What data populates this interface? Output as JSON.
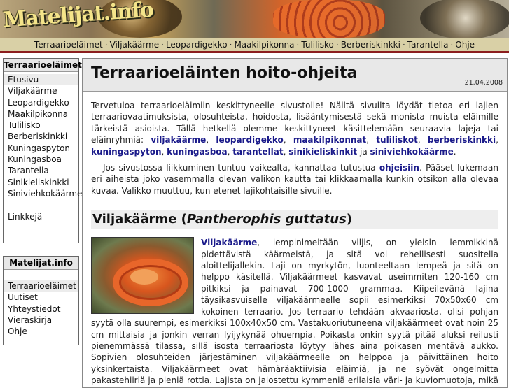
{
  "header": {
    "logo_text": "Matelijat.info"
  },
  "topnav": [
    "Terraarioeläimet",
    "Viljakäärme",
    "Leopardigekko",
    "Maakilpikonna",
    "Tulilisko",
    "Berberiskinkki",
    "Tarantella",
    "Ohje"
  ],
  "sidebar_animals": {
    "title": "Terraarioeläimet",
    "items": [
      "Etusivu",
      "Viljakäärme",
      "Leopardigekko",
      "Maakilpikonna",
      "Tulilisko",
      "Berberiskinkki",
      "Kuningaspyton",
      "Kuningasboa",
      "Tarantella",
      "Sinikieliskinkki",
      "Siniviehkokäärme"
    ],
    "extra": "Linkkejä"
  },
  "sidebar_site": {
    "title": "Matelijat.info",
    "items": [
      "Terraarioeläimet",
      "Uutiset",
      "Yhteystiedot",
      "Vieraskirja",
      "Ohje"
    ]
  },
  "main": {
    "title": "Terraarioeläinten hoito-ohjeita",
    "date": "21.04.2008",
    "intro": {
      "text1": "Tervetuloa terraarioeläimiin keskittyneelle sivustolle! Näiltä sivuilta löydät tietoa eri lajien terraariovaatimuksista, olosuhteista, hoidosta, lisääntymisestä sekä monista muista eläimille tärkeistä asioista. Tällä hetkellä olemme keskittyneet käsittelemään seuraavia lajeja tai eläinryhmiä: ",
      "links": [
        "viljakäärme",
        "leopardigekko",
        "maakilpikonnat",
        "tuliliskot",
        "berberiskinkki",
        "kuningaspyton",
        "kuningasboa",
        "tarantellat",
        "sinikieliskinkit",
        "siniviehkokäärme"
      ],
      "text_and": " ja ",
      "end": "."
    },
    "help": {
      "before": "Jos sivustossa liikkuminen tuntuu vaikealta, kannattaa tutustua ",
      "link": "ohjeisiin",
      "after": ". Pääset lukemaan eri aiheista joko vasemmalla olevan valikon kautta tai klikkaamalla kunkin otsikon alla olevaa kuvaa. Valikko muuttuu, kun etenet lajikohtaisille sivuille."
    },
    "section": {
      "heading_plain": "Viljakäärme (",
      "heading_italic": "Pantherophis guttatus",
      "heading_close": ")",
      "link": "Viljakäärme",
      "text": ", lempinimeltään viljis, on yleisin lemmikkinä pidettävistä käärmeistä, ja sitä voi rehellisesti suositella aloittelijallekin. Laji on myrkytön, luonteeltaan lempeä ja sitä on helppo käsitellä. Viljakäärmeet kasvavat useimmiten 120-160 cm pitkiksi ja painavat 700-1000 grammaa. Kiipeilevänä lajina täysikasvuiselle viljakäärmeelle sopii esimerkiksi 70x50x60 cm kokoinen terraario. Jos terraario tehdään akvaariosta, olisi pohjan syytä olla suurempi, esimerkiksi 100x40x50 cm. Vastakuoriutuneena viljakäärmeet ovat noin 25 cm mittaisia ja jonkin verran lyijykynää ohuempia. Poikasta onkin syytä pitää aluksi reilusti pienemmässä tilassa, sillä isosta terraariosta löytyy lähes aina poikasen mentävä aukko. Sopivien olosuhteiden järjestäminen viljakäärmeelle on helppoa ja päivittäinen hoito yksinkertaista. Viljakäärmeet ovat hämäräaktiivisia eläimiä, ja ne syövät ongelmitta pakastehiiriä ja pieniä rottia. Lajista on jalostettu kymmeniä erilaisia väri- ja kuviomuotoja, mikä monien mielestä tekee viljakäärmeestä entistä mielenkiintoisemman. ."
    }
  }
}
